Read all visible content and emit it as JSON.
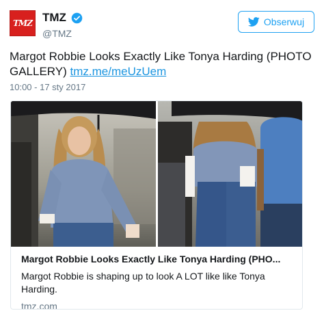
{
  "account": {
    "avatar_text": "TMZ",
    "display_name": "TMZ",
    "handle": "@TMZ",
    "verified_icon": "verified-badge-icon"
  },
  "follow_button": {
    "label": "Obserwuj",
    "icon": "bird-icon"
  },
  "tweet": {
    "text": "Margot Robbie Looks Exactly Like Tonya Harding (PHOTO GALLERY) ",
    "link": "tmz.me/meUzUem",
    "timestamp": "10:00 - 17 sty 2017"
  },
  "card": {
    "title": "Margot Robbie Looks Exactly Like Tonya Harding (PHO...",
    "description": "Margot Robbie is shaping up to look A LOT like like Tonya Harding.",
    "domain": "tmz.com"
  },
  "colors": {
    "accent": "#1da1f2",
    "link": "#1b95e0",
    "avatar_bg": "#d8201e",
    "muted": "#657786"
  }
}
